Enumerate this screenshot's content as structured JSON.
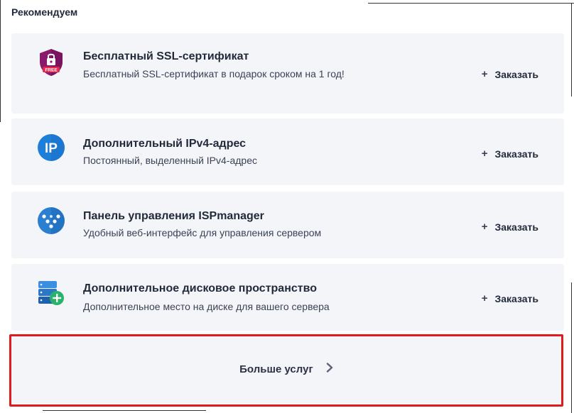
{
  "section": {
    "title": "Рекомендуем"
  },
  "services": [
    {
      "icon": "ssl-free-shield-icon",
      "title": "Бесплатный SSL-сертификат",
      "description": "Бесплатный SSL-сертификат в подарок сроком на 1 год!",
      "order_label": "Заказать",
      "order_icon": "plus-icon"
    },
    {
      "icon": "ip-address-icon",
      "title": "Дополнительный IPv4-адрес",
      "description": "Постоянный, выделенный IPv4-адрес",
      "order_label": "Заказать",
      "order_icon": "plus-icon"
    },
    {
      "icon": "ispmanager-logo-icon",
      "title": "Панель управления ISPmanager",
      "description": "Удобный веб-интерфейс для управления сервером",
      "order_label": "Заказать",
      "order_icon": "plus-icon"
    },
    {
      "icon": "disk-add-icon",
      "title": "Дополнительное дисковое пространство",
      "description": "Дополнительное место на диске для вашего сервера",
      "order_label": "Заказать",
      "order_icon": "plus-icon"
    }
  ],
  "ssl_badge_text": "FREE",
  "ip_icon_text": "IP",
  "more": {
    "label": "Больше услуг",
    "icon": "chevron-right-icon"
  },
  "colors": {
    "card_bg": "#f4f5f9",
    "highlight_border": "#e01b1b",
    "ip_blue": "#1e7fd8",
    "ssl_purple": "#8a1a6b",
    "disk_blue": "#2b78c8",
    "add_green": "#27b36a"
  }
}
